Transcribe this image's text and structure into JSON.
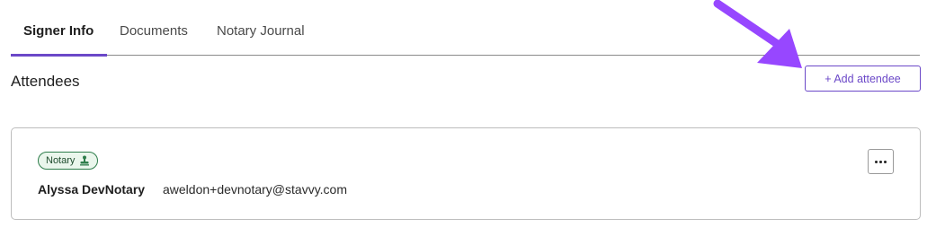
{
  "tabs": [
    {
      "label": "Signer Info",
      "active": true
    },
    {
      "label": "Documents",
      "active": false
    },
    {
      "label": "Notary Journal",
      "active": false
    }
  ],
  "attendees_section": {
    "title": "Attendees",
    "add_button_label": "+ Add attendee"
  },
  "attendees": [
    {
      "role": "Notary",
      "role_icon": "stamp-icon",
      "name": "Alyssa DevNotary",
      "email": "aweldon+devnotary@stavvy.com",
      "menu_icon": "more-icon"
    }
  ],
  "colors": {
    "accent": "#6b48c8",
    "annotation_arrow": "#9747ff",
    "badge_border": "#2e7d4b",
    "badge_bg": "#eaf6ec"
  }
}
